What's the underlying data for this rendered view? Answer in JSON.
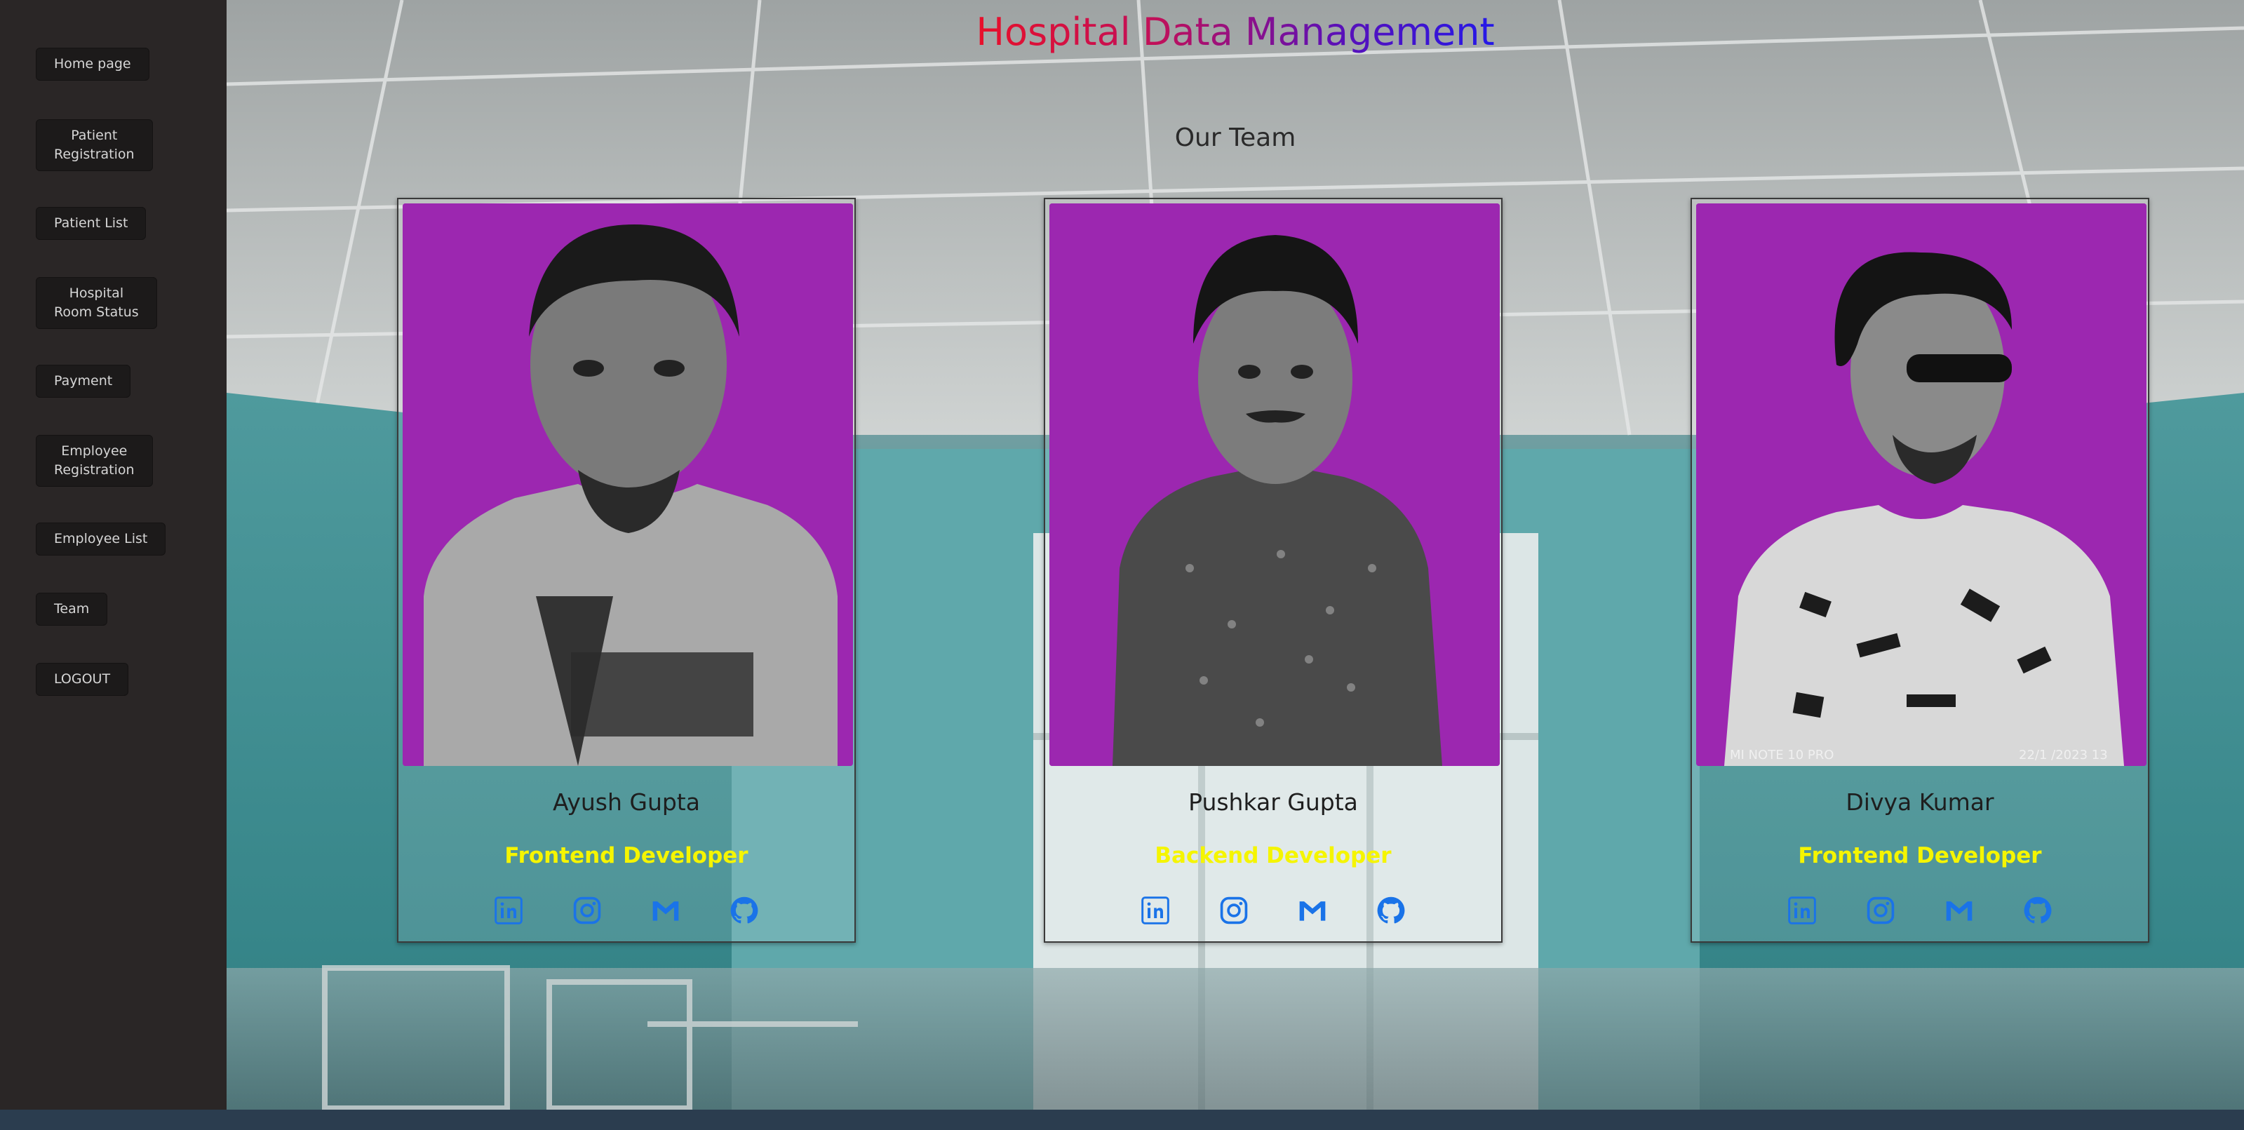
{
  "sidebar": {
    "items": [
      {
        "label": "Home page"
      },
      {
        "label": "Patient\nRegistration"
      },
      {
        "label": "Patient List"
      },
      {
        "label": "Hospital\nRoom Status"
      },
      {
        "label": "Payment"
      },
      {
        "label": "Employee\nRegistration"
      },
      {
        "label": "Employee List"
      },
      {
        "label": "Team"
      },
      {
        "label": "LOGOUT"
      }
    ]
  },
  "header": {
    "title": "Hospital Data Management",
    "subtitle": "Our Team"
  },
  "team": [
    {
      "name": "Ayush Gupta",
      "role": "Frontend Developer"
    },
    {
      "name": "Pushkar Gupta",
      "role": "Backend Developer"
    },
    {
      "name": "Divya Kumar",
      "role": "Frontend Developer",
      "photo_caption_left": "MI NOTE 10 PRO",
      "photo_caption_right": "22/1  /2023  13"
    }
  ],
  "social_icons": [
    "linkedin-icon",
    "instagram-icon",
    "gmail-icon",
    "github-icon"
  ],
  "colors": {
    "title_gradient_start": "#e8102a",
    "title_gradient_end": "#2418e8",
    "role_text": "#f5f500",
    "photo_bg": "#9c27b0",
    "icon_blue": "#1a73e8",
    "sidebar_bg": "#2a2626"
  }
}
